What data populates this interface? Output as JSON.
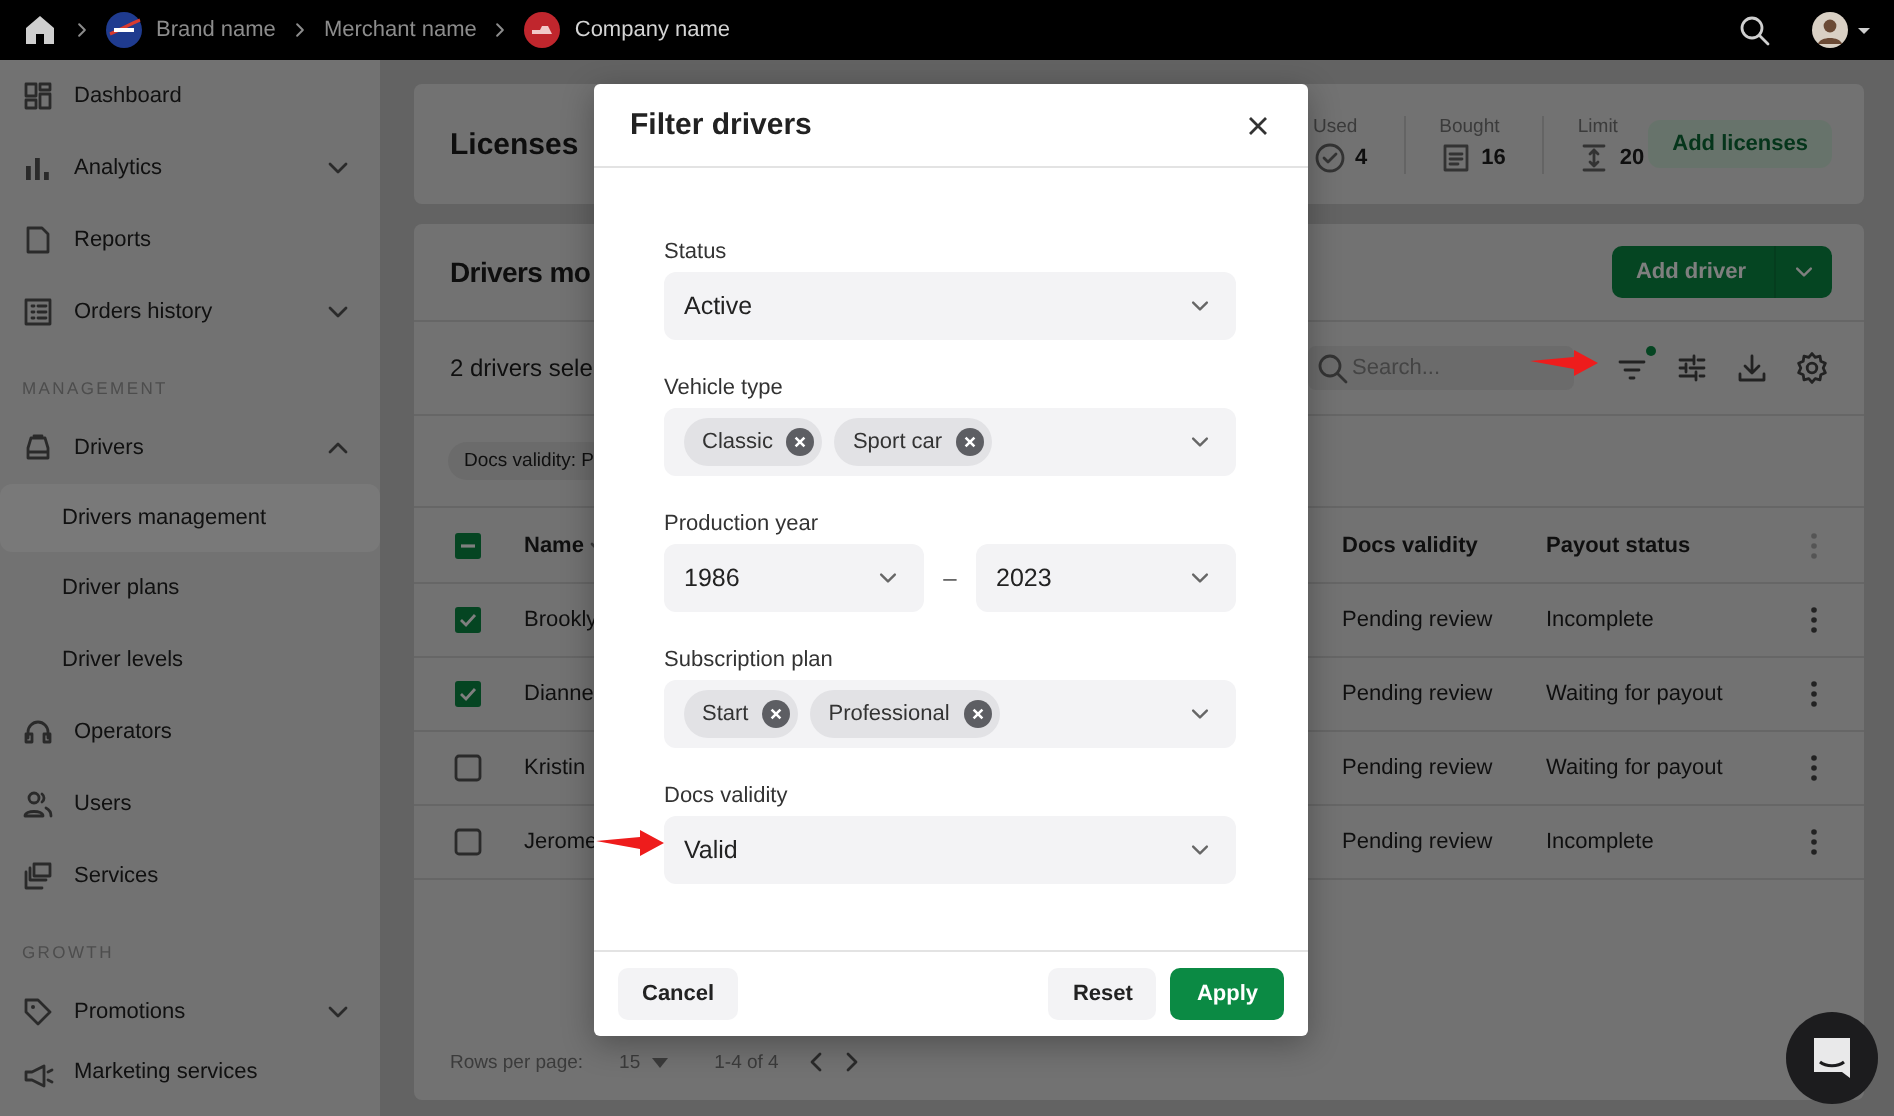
{
  "topbar": {
    "breadcrumbs": [
      {
        "label": "Brand name",
        "kind": "blue-logo"
      },
      {
        "label": "Merchant name",
        "kind": "plain"
      },
      {
        "label": "Company name",
        "kind": "red-logo"
      }
    ]
  },
  "sidebar": {
    "sections": [
      {
        "items": [
          {
            "label": "Dashboard",
            "selected": false
          },
          {
            "label": "Analytics",
            "expanded": false,
            "selected": false
          },
          {
            "label": "Reports",
            "selected": false
          },
          {
            "label": "Orders history",
            "expanded": false,
            "selected": false
          }
        ]
      },
      {
        "heading": "MANAGEMENT",
        "items": [
          {
            "label": "Drivers",
            "expanded": true,
            "selected": false,
            "children": [
              {
                "label": "Drivers management",
                "selected": true
              },
              {
                "label": "Driver plans",
                "selected": false
              },
              {
                "label": "Driver levels",
                "selected": false
              }
            ]
          },
          {
            "label": "Operators",
            "selected": false
          },
          {
            "label": "Users",
            "selected": false
          },
          {
            "label": "Services",
            "selected": false
          }
        ]
      },
      {
        "heading": "GROWTH",
        "items": [
          {
            "label": "Promotions",
            "expanded": false,
            "selected": false
          },
          {
            "label": "Marketing services",
            "selected": false
          }
        ]
      }
    ]
  },
  "licenses": {
    "title": "Licenses",
    "stats": [
      {
        "label": "Used",
        "value": "4"
      },
      {
        "label": "Bought",
        "value": "16"
      },
      {
        "label": "Limit",
        "value": "20"
      }
    ],
    "button": "Add licenses"
  },
  "drivers": {
    "title": "Drivers mo",
    "add_button": "Add driver",
    "selection": "2 drivers sele",
    "search": {
      "placeholder": "Search..."
    },
    "filters_active": true,
    "chips": [
      "Docs validity: P"
    ],
    "table": {
      "select_all": {
        "partial": true
      },
      "columns": [
        "Name",
        "Docs validity",
        "Payout status"
      ],
      "rows": [
        {
          "selected": true,
          "name": "Brookly",
          "docs_validity": "Pending review",
          "payout_status": "Incomplete"
        },
        {
          "selected": true,
          "name": "Dianne",
          "docs_validity": "Pending review",
          "payout_status": "Waiting for payout"
        },
        {
          "selected": false,
          "name": "Kristin",
          "docs_validity": "Pending review",
          "payout_status": "Waiting for payout"
        },
        {
          "selected": false,
          "name": "Jerome",
          "docs_validity": "Pending review",
          "payout_status": "Incomplete"
        }
      ]
    },
    "pagination": {
      "rows_label": "Rows per page:",
      "rows_value": "15",
      "range": "1-4 of 4"
    }
  },
  "modal": {
    "title": "Filter drivers",
    "fields": [
      {
        "label": "Status",
        "kind": "select",
        "value": "Active"
      },
      {
        "label": "Vehicle type",
        "kind": "multi",
        "chips": [
          "Classic",
          "Sport car"
        ]
      },
      {
        "label": "Production year",
        "kind": "range",
        "from": "1986",
        "separator": "–",
        "to": "2023"
      },
      {
        "label": "Subscription plan",
        "kind": "multi",
        "chips": [
          "Start",
          "Professional"
        ]
      },
      {
        "label": "Docs validity",
        "kind": "select",
        "value": "Valid"
      }
    ],
    "buttons": {
      "cancel": "Cancel",
      "reset": "Reset",
      "apply": "Apply"
    }
  }
}
